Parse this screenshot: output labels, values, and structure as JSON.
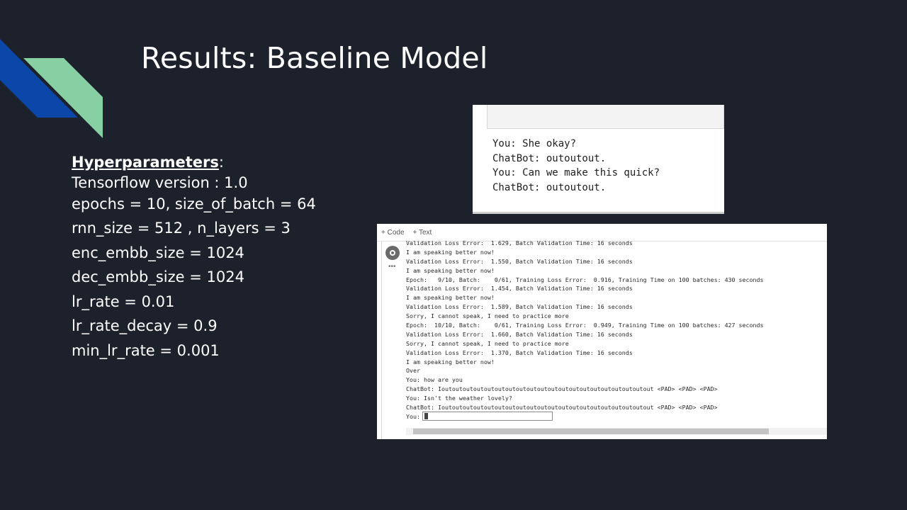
{
  "slide": {
    "title": "Results: Baseline Model",
    "colors": {
      "background": "#1d212b",
      "accent_blue": "#0a47a8",
      "accent_green": "#86d0a3"
    }
  },
  "hyperparameters": {
    "heading": "Hyperparameters",
    "heading_suffix": ":",
    "lines": [
      "Tensorflow version : 1.0",
      "epochs = 10, size_of_batch = 64",
      "rnn_size = 512 , n_layers = 3",
      "enc_embb_size = 1024",
      "dec_embb_size = 1024",
      "lr_rate = 0.01",
      "lr_rate_decay = 0.9",
      "min_lr_rate = 0.001"
    ]
  },
  "screenshot1": {
    "lines": [
      "You: She okay?",
      "ChatBot: outoutout.",
      "You: Can we make this quick?",
      "ChatBot: outoutout."
    ]
  },
  "screenshot2": {
    "toolbar": {
      "code_button": "+ Code",
      "text_button": "+ Text"
    },
    "more_icon": "ellipsis-icon",
    "run_icon": "run-cell-icon",
    "output_lines": [
      "Validation Loss Error:  1.629, Batch Validation Time: 16 seconds",
      "I am speaking better now!",
      "Validation Loss Error:  1.550, Batch Validation Time: 16 seconds",
      "I am speaking better now!",
      "Epoch:   9/10, Batch:    0/61, Training Loss Error:  0.916, Training Time on 100 batches: 430 seconds",
      "Validation Loss Error:  1.454, Batch Validation Time: 16 seconds",
      "I am speaking better now!",
      "Validation Loss Error:  1.589, Batch Validation Time: 16 seconds",
      "Sorry, I cannot speak, I need to practice more",
      "Epoch:  10/10, Batch:    0/61, Training Loss Error:  0.949, Training Time on 100 batches: 427 seconds",
      "Validation Loss Error:  1.660, Batch Validation Time: 16 seconds",
      "Sorry, I cannot speak, I need to practice more",
      "Validation Loss Error:  1.370, Batch Validation Time: 16 seconds",
      "I am speaking better now!",
      "Over",
      "You: how are you",
      "ChatBot: Ioutoutoutoutoutoutoutoutoutoutoutoutoutoutoutoutoutoutoutout <PAD> <PAD> <PAD>",
      "You: Isn't the weather lovely?",
      "ChatBot: Ioutoutoutoutoutoutoutoutoutoutoutoutoutoutoutoutoutoutoutout <PAD> <PAD> <PAD>"
    ],
    "prompt_label": "You:",
    "prompt_value": ""
  }
}
